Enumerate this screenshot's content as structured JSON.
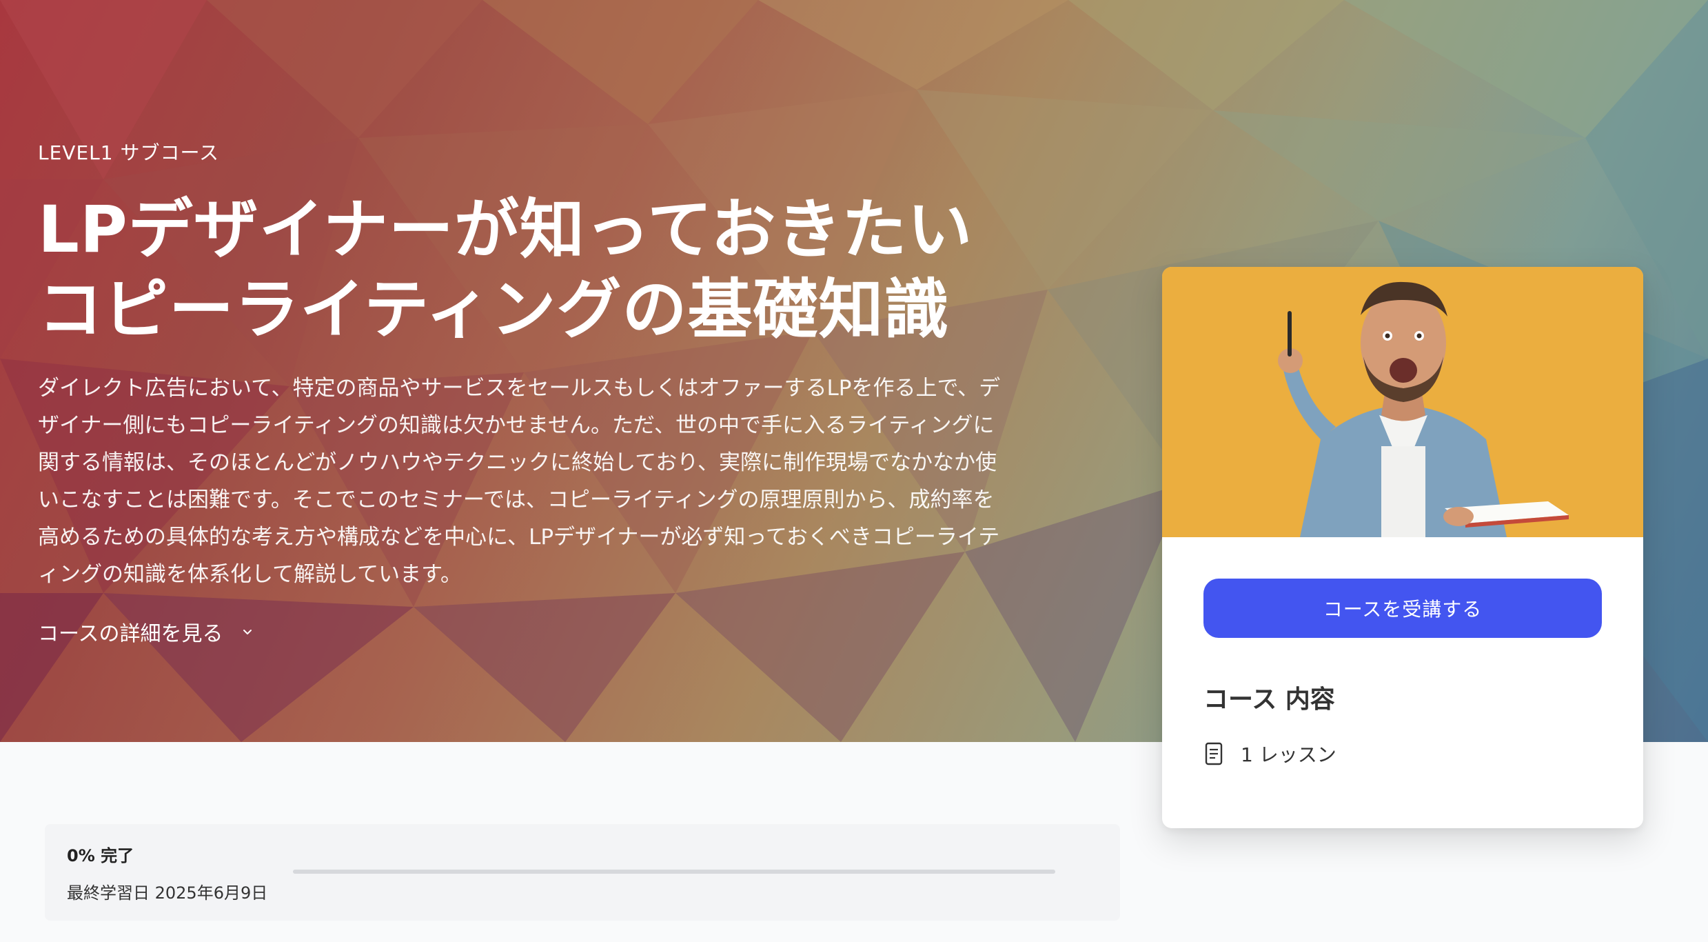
{
  "hero": {
    "eyebrow": "LEVEL1 サブコース",
    "title_line1": "LPデザイナーが知っておきたい",
    "title_line2": "コピーライティングの基礎知識",
    "description": "ダイレクト広告において、特定の商品やサービスをセールスもしくはオファーするLPを作る上で、デザイナー側にもコピーライティングの知識は欠かせません。ただ、世の中で手に入るライティングに関する情報は、そのほとんどがノウハウやテクニックに終始しており、実際に制作現場でなかなか使いこなすことは困難です。そこでこのセミナーでは、コピーライティングの原理原則から、成約率を高めるための具体的な考え方や構成などを中心に、LPデザイナーが必ず知っておくべきコピーライティングの知識を体系化して解説しています。",
    "details_toggle": "コースの詳細を見る",
    "details_icon": "chevron-down-icon"
  },
  "card": {
    "image_alt": "man-holding-pen-and-book",
    "enroll_label": "コースを受講する",
    "content_heading": "コース 内容",
    "lesson_count": "1 レッスン",
    "lesson_icon": "document-icon"
  },
  "progress": {
    "percent_label": "0% 完了",
    "percent": 0,
    "last_study": "最終学習日 2025年6月9日"
  },
  "colors": {
    "accent": "#4355f0",
    "card_image_bg": "#e8a93c"
  }
}
